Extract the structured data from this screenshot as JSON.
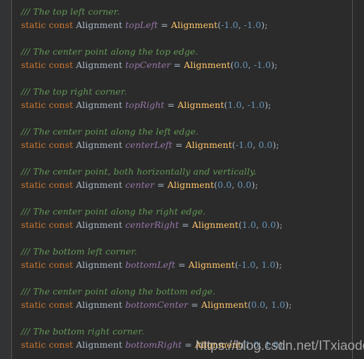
{
  "editor": {
    "language": "dart",
    "background_color": "#2b2b2b",
    "gutter_color": "#313335",
    "separator_color": "#555555"
  },
  "theme_colors": {
    "comment": "#629755",
    "keyword": "#cc7832",
    "type": "#a9b7c6",
    "field": "#9876aa",
    "constructor": "#ffc66d",
    "number": "#6897bb",
    "punctuation": "#a9b7c6"
  },
  "tokens": {
    "static": "static",
    "const": "const",
    "type": "Alignment",
    "equals": "=",
    "ctor": "Alignment",
    "open_paren": "(",
    "close_paren": ")",
    "comma": ",",
    "semicolon": ";",
    "space": " "
  },
  "code_blocks": [
    {
      "comment": "/// The top left corner.",
      "name": "topLeft",
      "x": "-1.0",
      "y": "-1.0"
    },
    {
      "comment": "/// The center point along the top edge.",
      "name": "topCenter",
      "x": "0.0",
      "y": "-1.0"
    },
    {
      "comment": "/// The top right corner.",
      "name": "topRight",
      "x": "1.0",
      "y": "-1.0"
    },
    {
      "comment": "/// The center point along the left edge.",
      "name": "centerLeft",
      "x": "-1.0",
      "y": "0.0"
    },
    {
      "comment": "/// The center point, both horizontally and vertically.",
      "name": "center",
      "x": "0.0",
      "y": "0.0"
    },
    {
      "comment": "/// The center point along the right edge.",
      "name": "centerRight",
      "x": "1.0",
      "y": "0.0"
    },
    {
      "comment": "/// The bottom left corner.",
      "name": "bottomLeft",
      "x": "-1.0",
      "y": "1.0"
    },
    {
      "comment": "/// The center point along the bottom edge.",
      "name": "bottomCenter",
      "x": "0.0",
      "y": "1.0"
    },
    {
      "comment": "/// The bottom right corner.",
      "name": "bottomRight",
      "x": "1.0",
      "y": "1.0"
    }
  ],
  "watermark": {
    "text": "https://blog.csdn.net/ITxiaodong",
    "color": "#cfcfcf"
  }
}
